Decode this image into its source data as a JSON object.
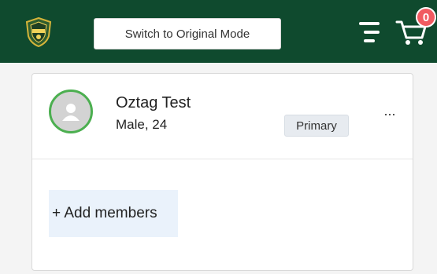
{
  "header": {
    "logo_icon": "club-shield-logo",
    "mode_button_label": "Switch to Original Mode",
    "menu_icon": "hamburger-menu-icon",
    "cart_icon": "shopping-cart-icon",
    "cart_count": "0",
    "colors": {
      "bar": "#0f4a2e",
      "badge": "#f15b61"
    }
  },
  "member": {
    "avatar_icon": "user-avatar-icon",
    "name": "Oztag Test",
    "info": "Male, 24",
    "badge": "Primary",
    "more_icon": "more-options-icon",
    "more_glyph": "···",
    "avatar_ring_color": "#4caf50"
  },
  "actions": {
    "add_members_label": "+ Add members"
  }
}
